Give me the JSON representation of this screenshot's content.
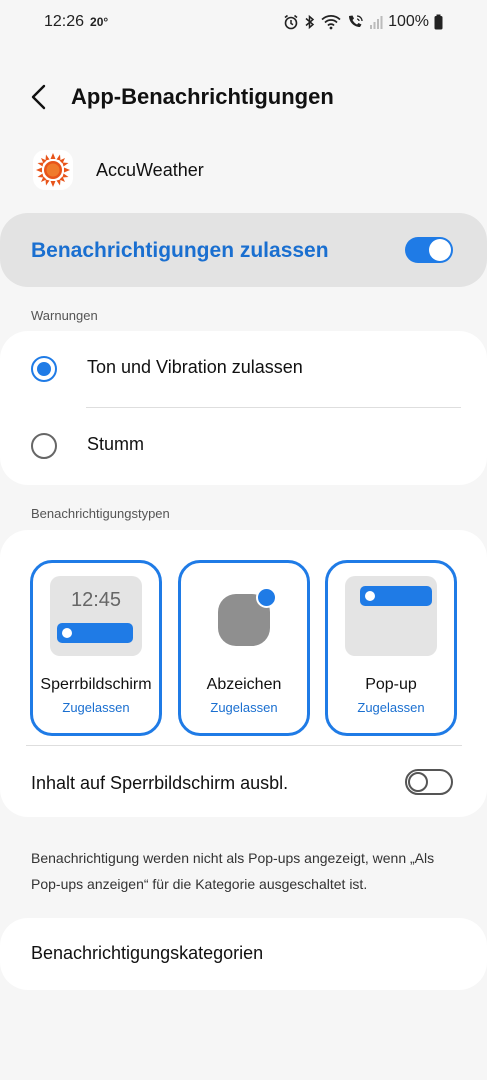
{
  "status_bar": {
    "time": "12:26",
    "temperature": "20°",
    "battery": "100%"
  },
  "header": {
    "title": "App-Benachrichtigungen"
  },
  "app": {
    "name": "AccuWeather",
    "icon": "sun-icon"
  },
  "allow": {
    "label": "Benachrichtigungen zulassen",
    "enabled": true
  },
  "warnings": {
    "section_label": "Warnungen",
    "options": [
      {
        "label": "Ton und Vibration zulassen",
        "selected": true
      },
      {
        "label": "Stumm",
        "selected": false
      }
    ]
  },
  "types": {
    "section_label": "Benachrichtigungstypen",
    "items": [
      {
        "title": "Sperrbildschirm",
        "status": "Zugelassen",
        "preview_time": "12:45"
      },
      {
        "title": "Abzeichen",
        "status": "Zugelassen"
      },
      {
        "title": "Pop-up",
        "status": "Zugelassen"
      }
    ],
    "hide_content_label": "Inhalt auf Sperrbildschirm ausbl.",
    "hide_content_enabled": false
  },
  "info": {
    "text": "Benachrichtigung werden nicht als Pop-ups angezeigt, wenn „Als Pop-ups anzeigen“ für die Kategorie ausgeschaltet ist."
  },
  "categories": {
    "label": "Benachrichtigungskategorien"
  },
  "colors": {
    "accent": "#1f7be6",
    "accent_text": "#1a6fd0",
    "background": "#f6f6f6",
    "app_icon_orange": "#e8541a"
  }
}
